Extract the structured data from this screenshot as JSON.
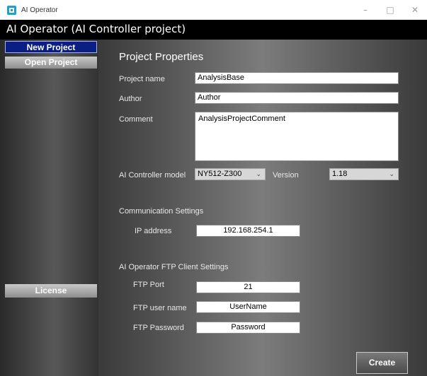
{
  "window": {
    "title": "AI Operator",
    "minimize": "–",
    "maximize": "□",
    "close": "✕"
  },
  "app": {
    "title": "AI Operator (AI Controller project)"
  },
  "sidebar": {
    "new_project": "New Project",
    "open_project": "Open Project",
    "license": "License"
  },
  "project_properties": {
    "title": "Project Properties",
    "project_name_label": "Project name",
    "project_name_value": "AnalysisBase",
    "author_label": "Author",
    "author_value": "Author",
    "comment_label": "Comment",
    "comment_value": "AnalysisProjectComment",
    "controller_model_label": "AI Controller model",
    "controller_model_value": "NY512-Z300",
    "version_label": "Version",
    "version_value": "1.18"
  },
  "communication": {
    "title": "Communication Settings",
    "ip_label": "IP address",
    "ip_value": "192.168.254.1"
  },
  "ftp": {
    "title": "AI Operator FTP Client Settings",
    "port_label": "FTP Port",
    "port_value": "21",
    "user_label": "FTP user name",
    "user_value": "UserName",
    "password_label": "FTP Password",
    "password_value": "Password"
  },
  "actions": {
    "create": "Create"
  },
  "colors": {
    "accent": "#0c1e82",
    "icon": "#1fa0c8"
  }
}
